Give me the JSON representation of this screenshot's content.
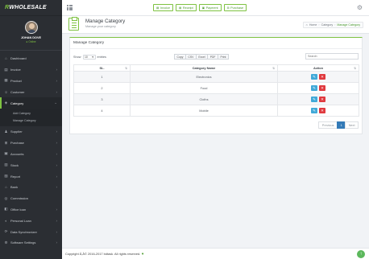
{
  "app": {
    "logo_prefix": "R",
    "logo_brand": "WHOLESALE"
  },
  "user": {
    "name": "JOHAN DOVE",
    "status": "Online"
  },
  "sidebar": {
    "items": [
      {
        "label": "Dashboard",
        "icon": "dashboard-icon",
        "glyph": "⌂",
        "chevron": false
      },
      {
        "label": "Invoice",
        "icon": "invoice-icon",
        "glyph": "▤",
        "chevron": true
      },
      {
        "label": "Product",
        "icon": "product-icon",
        "glyph": "▦",
        "chevron": true
      },
      {
        "label": "Customer",
        "icon": "customer-icon",
        "glyph": "☺",
        "chevron": true
      },
      {
        "label": "Category",
        "icon": "category-icon",
        "glyph": "◈",
        "chevron": true,
        "active": true
      },
      {
        "label": "Supplier",
        "icon": "supplier-icon",
        "glyph": "♟",
        "chevron": true
      },
      {
        "label": "Purchase",
        "icon": "purchase-icon",
        "glyph": "⊞",
        "chevron": true
      },
      {
        "label": "Accounts",
        "icon": "accounts-icon",
        "glyph": "▣",
        "chevron": true
      },
      {
        "label": "Stock",
        "icon": "stock-icon",
        "glyph": "▥",
        "chevron": true
      },
      {
        "label": "Report",
        "icon": "report-icon",
        "glyph": "▧",
        "chevron": true
      },
      {
        "label": "Bank",
        "icon": "bank-icon",
        "glyph": "⌂",
        "chevron": true
      },
      {
        "label": "Commission",
        "icon": "commission-icon",
        "glyph": "◎",
        "chevron": false
      },
      {
        "label": "Office loan",
        "icon": "office-loan-icon",
        "glyph": "◧",
        "chevron": true
      },
      {
        "label": "Personal Loan",
        "icon": "personal-loan-icon",
        "glyph": "◐",
        "chevron": true
      },
      {
        "label": "Data Synchronizer",
        "icon": "sync-icon",
        "glyph": "⟳",
        "chevron": true
      },
      {
        "label": "Software Settings",
        "icon": "settings-icon",
        "glyph": "⚙",
        "chevron": true
      }
    ],
    "sub_items": [
      "Add Category",
      "Manage Category"
    ]
  },
  "topbar": {
    "buttons": [
      {
        "label": "Invoice",
        "glyph": "▤"
      },
      {
        "label": "Receipt",
        "glyph": "▤"
      },
      {
        "label": "Payment",
        "glyph": "▣"
      },
      {
        "label": "Purchase",
        "glyph": "⊞"
      }
    ]
  },
  "page": {
    "title": "Manage Category",
    "subtitle": "Manage your category",
    "breadcrumb": {
      "home": "Home",
      "section": "Category",
      "current": "Manage Category"
    }
  },
  "panel": {
    "title": "Manage Category",
    "show_label": "Show",
    "show_value": "10",
    "entries_label": "entries",
    "export_buttons": [
      "Copy",
      "CSV",
      "Excel",
      "PDF",
      "Print"
    ],
    "search_placeholder": "Search:"
  },
  "table": {
    "headers": [
      "SL.",
      "Category Name",
      "Action"
    ],
    "rows": [
      {
        "sl": "1",
        "name": "Electronics"
      },
      {
        "sl": "2",
        "name": "Food"
      },
      {
        "sl": "3",
        "name": "Cloths"
      },
      {
        "sl": "4",
        "name": "Mobile"
      }
    ]
  },
  "pagination": {
    "previous": "Previous",
    "page": "1",
    "next": "Next"
  },
  "footer": {
    "text": "Copyright Â,Â© 2016-2017 bdtask. All rights reserved."
  },
  "colors": {
    "accent": "#7ec241",
    "sidebar_bg": "#2b2e33",
    "edit": "#40a9d8",
    "delete": "#e0393e"
  }
}
